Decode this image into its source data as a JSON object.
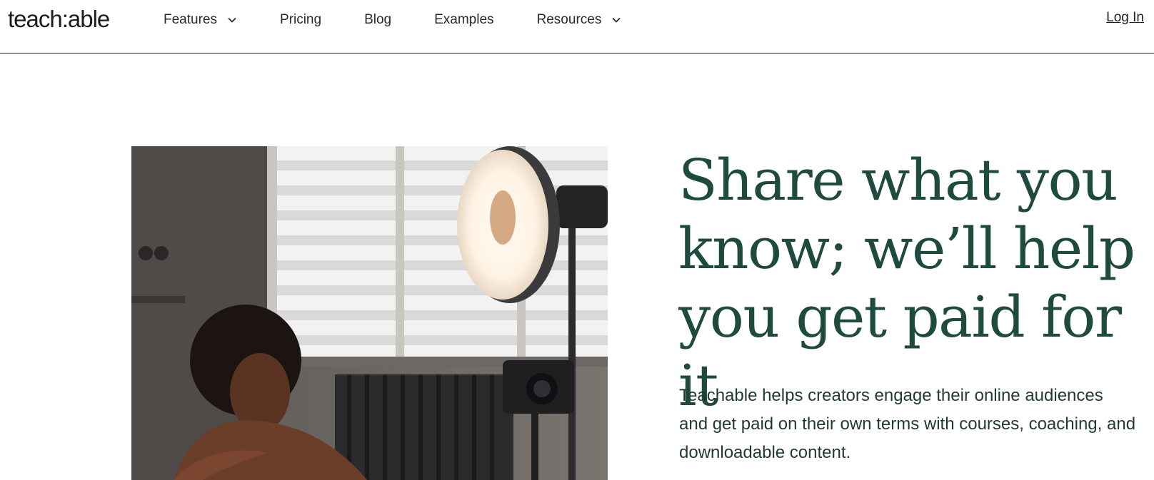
{
  "header": {
    "logo": "teach:able",
    "nav": [
      {
        "label": "Features",
        "has_dropdown": true
      },
      {
        "label": "Pricing",
        "has_dropdown": false
      },
      {
        "label": "Blog",
        "has_dropdown": false
      },
      {
        "label": "Examples",
        "has_dropdown": false
      },
      {
        "label": "Resources",
        "has_dropdown": true
      }
    ],
    "login_label": "Log In"
  },
  "hero": {
    "title": "Share what you know; we’ll help you get paid for it",
    "subtitle": "Teachable helps creators engage their online audiences and get paid on their own terms with courses, coaching, and downloadable content.",
    "image_icon": "photo-creator-with-ring-light-and-camera"
  },
  "colors": {
    "title": "#1f4a3f",
    "text": "#1f3a33",
    "header_border": "#1d1d1d"
  }
}
